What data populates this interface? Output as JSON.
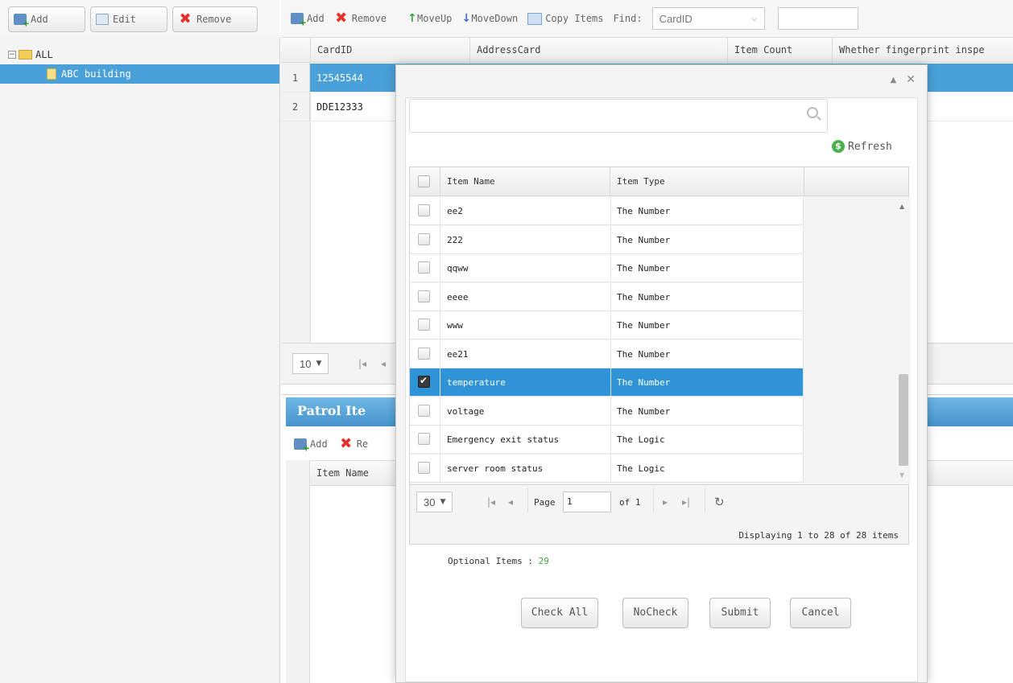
{
  "left_toolbar": {
    "add_label": "Add",
    "edit_label": "Edit",
    "remove_label": "Remove"
  },
  "tree": {
    "root_label": "ALL",
    "child_label": "ABC building"
  },
  "main_toolbar": {
    "add_label": "Add",
    "remove_label": "Remove",
    "moveup_label": "MoveUp",
    "movedown_label": "MoveDown",
    "copy_label": "Copy Items",
    "find_label": "Find:",
    "find_field_value": "CardID"
  },
  "grid": {
    "columns": [
      "CardID",
      "AddressCard",
      "Item Count",
      "Whether fingerprint inspe"
    ],
    "rows": [
      {
        "num": "1",
        "card_id": "12545544"
      },
      {
        "num": "2",
        "card_id": "DDE12333"
      }
    ],
    "page_size": "10"
  },
  "patrol": {
    "title": "Patrol Ite",
    "add_label": "Add",
    "remove_label": "Re",
    "column_item_name": "Item Name"
  },
  "dialog": {
    "search_placeholder": "",
    "refresh_label": "Refresh",
    "columns": [
      "Item Name",
      "Item Type"
    ],
    "items": [
      {
        "name": "ee2",
        "type": "The Number",
        "checked": false
      },
      {
        "name": "222",
        "type": "The Number",
        "checked": false
      },
      {
        "name": "qqww",
        "type": "The Number",
        "checked": false
      },
      {
        "name": "eeee",
        "type": "The Number",
        "checked": false
      },
      {
        "name": "www",
        "type": "The Number",
        "checked": false
      },
      {
        "name": "ee21",
        "type": "The Number",
        "checked": false
      },
      {
        "name": "temperature",
        "type": "The Number",
        "checked": true
      },
      {
        "name": "voltage",
        "type": "The Number",
        "checked": false
      },
      {
        "name": "Emergency exit status",
        "type": "The Logic",
        "checked": false
      },
      {
        "name": "server room status",
        "type": "The Logic",
        "checked": false
      }
    ],
    "pager": {
      "page_size": "30",
      "page_label": "Page",
      "page_value": "1",
      "of_label": "of 1",
      "display_text": "Displaying 1 to 28 of 28 items"
    },
    "optional_label": "Optional Items :",
    "optional_count": "29",
    "buttons": {
      "check_all": "Check All",
      "no_check": "NoCheck",
      "submit": "Submit",
      "cancel": "Cancel"
    }
  },
  "colors": {
    "selection_blue": "#4aa0d8",
    "dialog_selection": "#2f93d8",
    "panel_title_blue": "#4694cd",
    "remove_red": "#e3322b",
    "refresh_green": "#4bb04b",
    "count_green": "#4aa84a"
  }
}
